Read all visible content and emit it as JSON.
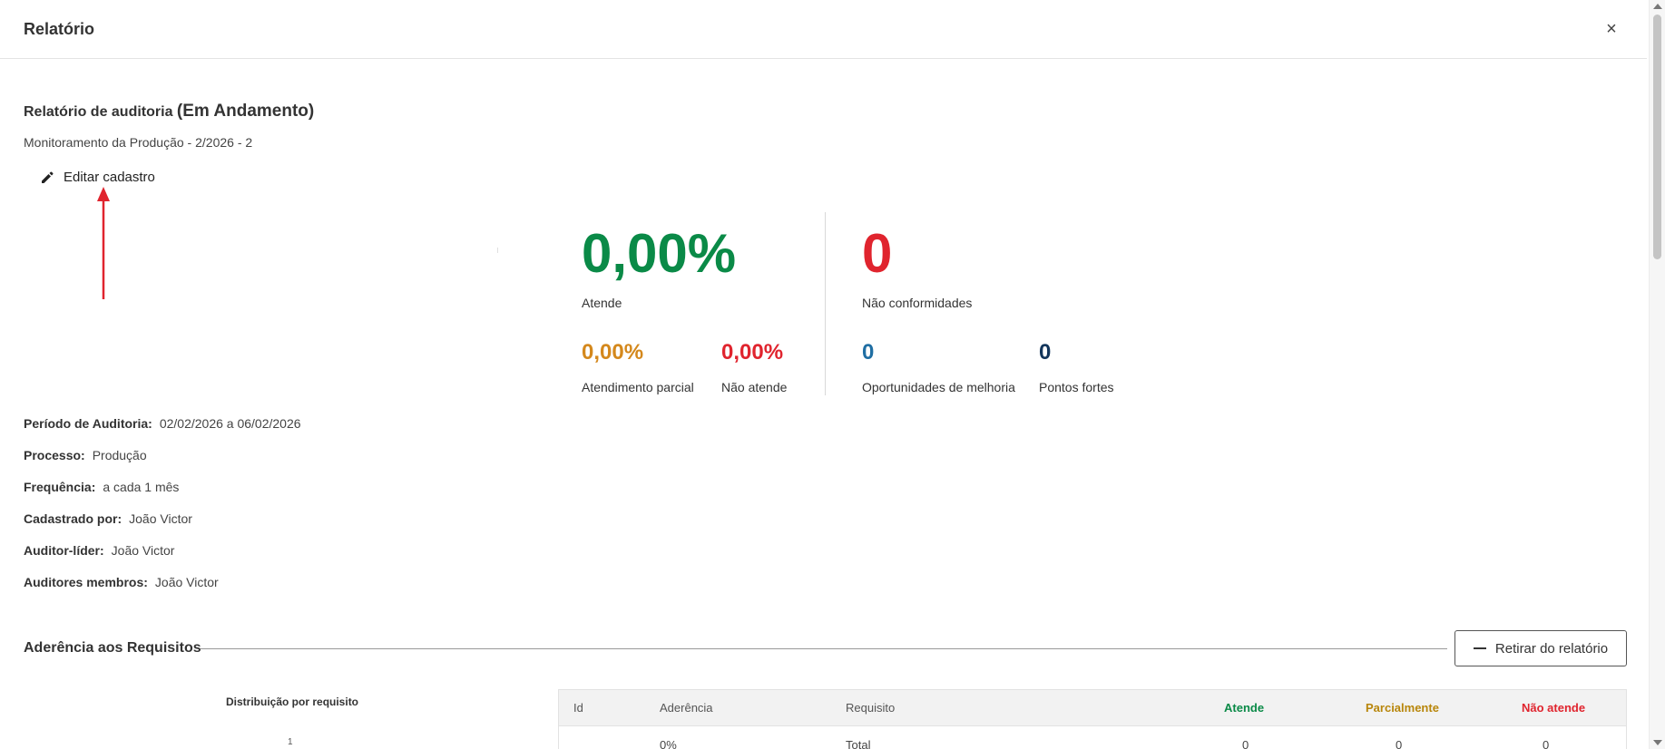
{
  "dialog": {
    "title": "Relatório",
    "close_label": "×"
  },
  "audit": {
    "title": "Relatório de auditoria",
    "status": "(Em Andamento)",
    "subtitle": "Monitoramento da Produção - 2/2026 - 2",
    "edit_label": "Editar cadastro"
  },
  "metrics": {
    "atende": {
      "value": "0,00%",
      "label": "Atende",
      "color": "#0a8a47"
    },
    "nao_conformidades": {
      "value": "0",
      "label": "Não conformidades",
      "color": "#e0242e"
    },
    "atendimento_parcial": {
      "value": "0,00%",
      "label": "Atendimento parcial",
      "color": "#d4881c"
    },
    "nao_atende": {
      "value": "0,00%",
      "label": "Não atende",
      "color": "#e0242e"
    },
    "oportunidades": {
      "value": "0",
      "label": "Oportunidades de melhoria",
      "color": "#1f6ea3"
    },
    "pontos_fortes": {
      "value": "0",
      "label": "Pontos fortes",
      "color": "#12355b"
    }
  },
  "info": [
    {
      "label": "Período de Auditoria:",
      "value": "02/02/2026 a 06/02/2026"
    },
    {
      "label": "Processo:",
      "value": "Produção"
    },
    {
      "label": "Frequência:",
      "value": "a cada 1 mês"
    },
    {
      "label": "Cadastrado por:",
      "value": "João Victor"
    },
    {
      "label": "Auditor-líder:",
      "value": "João Victor"
    },
    {
      "label": "Auditores membros:",
      "value": "João Victor"
    }
  ],
  "section": {
    "title": "Aderência aos Requisitos",
    "remove_button": "Retirar do relatório",
    "distribution_title": "Distribuição por requisito",
    "distribution_tick": "1"
  },
  "table": {
    "headers": {
      "id": "Id",
      "aderencia": "Aderência",
      "requisito": "Requisito",
      "atende": "Atende",
      "parcialmente": "Parcialmente",
      "nao_atende": "Não atende"
    },
    "rows": [
      {
        "id": "",
        "aderencia": "0%",
        "requisito": "Total",
        "atende": "0",
        "parcialmente": "0",
        "nao_atende": "0"
      }
    ]
  },
  "colors": {
    "annotation_arrow": "#e0242e",
    "header_green": "#0a8a47",
    "header_orange": "#b8860b",
    "header_red": "#e0242e"
  }
}
